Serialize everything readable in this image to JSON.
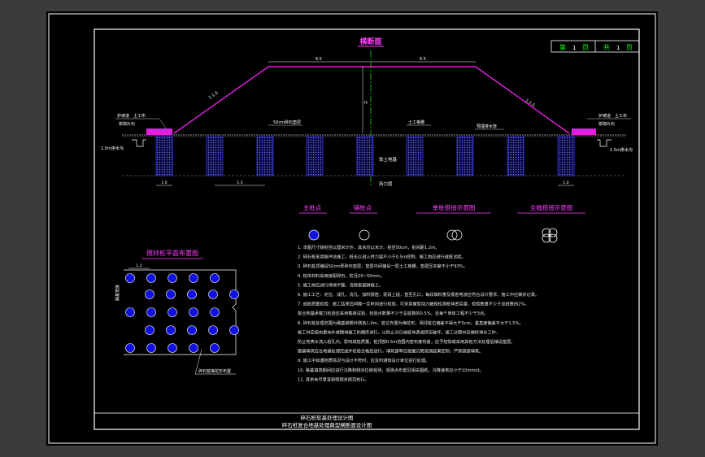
{
  "drawing": {
    "section_title": "横断面",
    "plan_title": "搅拌桩平面布置图",
    "page_box": {
      "page_label": "第",
      "page_num": "1",
      "page_unit": "页",
      "total_label": "共",
      "total_num": "1",
      "total_unit": "页"
    },
    "title_block": {
      "line1": "碎石桩软基处理设计图",
      "line2": "碎石桩复合地基处理典型横断面设计图"
    }
  },
  "section": {
    "dim_left": "6.5",
    "dim_right": "6.5",
    "slope_left": "1:1.5",
    "slope_right": "1:1.5",
    "height_label": "H",
    "label_cushion": "50cm碎石垫层",
    "label_geogrid": "土工格栅",
    "label_drain": "预埋排水管",
    "label_soft_soil": "软土地基",
    "label_bearing": "持力层",
    "label_left_a": "护坡道",
    "label_left_b": "土工布",
    "label_left_c": "浆砌片石",
    "label_right_a": "护坡道",
    "label_right_b": "土工布",
    "label_right_c": "浆砌片石",
    "label_ditch_left": "1.5m排水沟",
    "label_ditch_right": "1.5m排水沟",
    "label_spacing_left": "1.0",
    "label_spacing_mid": "1.5",
    "label_spacing_right": "1.0"
  },
  "legend": {
    "main_pile": "主桩点",
    "aux_pile": "辅桩点",
    "single_pile": "单桩搭接示意图",
    "full_pile": "全幅搭接示意图"
  },
  "plan": {
    "spacing_label": "1.2",
    "side_label": "路基宽度",
    "note_label": "碎石桩梅花形布置"
  },
  "notes": [
    "1. 本图尺寸除桩径以厘米计外，其余均以米计。桩径50cm，桩间距1.2m。",
    "2. 碎石桩采用振冲法施工，桩长以进入持力层不小于0.5m控制，施工前应进行成桩试验。",
    "3. 碎石桩顶铺设50cm厚碎石垫层，垫层中间铺设一层土工格栅，垫层压实度不小于93%。",
    "4. 桩体材料采用级配碎石，粒径20~50mm。",
    "5. 施工前应进行场地平整，清除表层耕植土。",
    "6. 施工工艺：定位、成孔、清孔、加料振密，逐段上提，直至孔口，每段填料量及振密电流应符合设计要求，施工中应做好记录。",
    "7. 成桩质量检验：施工结束后间隔一定时间进行检验，可采用重型动力触探检测桩体密实度，检验数量不少于总桩数的2%。",
    "   复合地基承载力检验应采用载荷试验，检验点数量不少于总桩数的0.5%，且每个单体工程不少于3点。",
    "8. 碎石桩处理范围为路基坡脚外侧各1.0m，桩位布置为梅花形，相邻桩位偏差不得大于5cm，垂直度偏差不大于1.5%。",
    "   施工时应按由里向外或隔排施工的顺序进行，以防止对已成桩体造成挤压破坏。施工过程中应做好排水工作，",
    "   防止地表水流入桩孔内，影响成桩质量。桩顶部0.5m范围内密实度较差，应予挖除或采用其他方法处理后铺设垫层。",
    "   路基填筑应在地基处理完成并检验合格后进行，填筑速率应根据沉降观测结果控制，严禁超速填筑。",
    "9. 施工中如遇地质情况与设计不符时，应及时通知设计单位进行处理。",
    "10. 路基填筑期间应进行沉降和侧向位移观测，观测点布置见相关图纸，沉降速率应小于10mm/d。",
    "11. 其余未尽事宜按照相关规范执行。"
  ],
  "colors": {
    "background": "#000000",
    "border": "#ffffff",
    "embankment": "#e020e0",
    "pile": "#3a3aff",
    "pile_fill": "#1010e0",
    "centerline": "#20d020",
    "text": "#e8e8e8",
    "title": "#ff40ff"
  }
}
